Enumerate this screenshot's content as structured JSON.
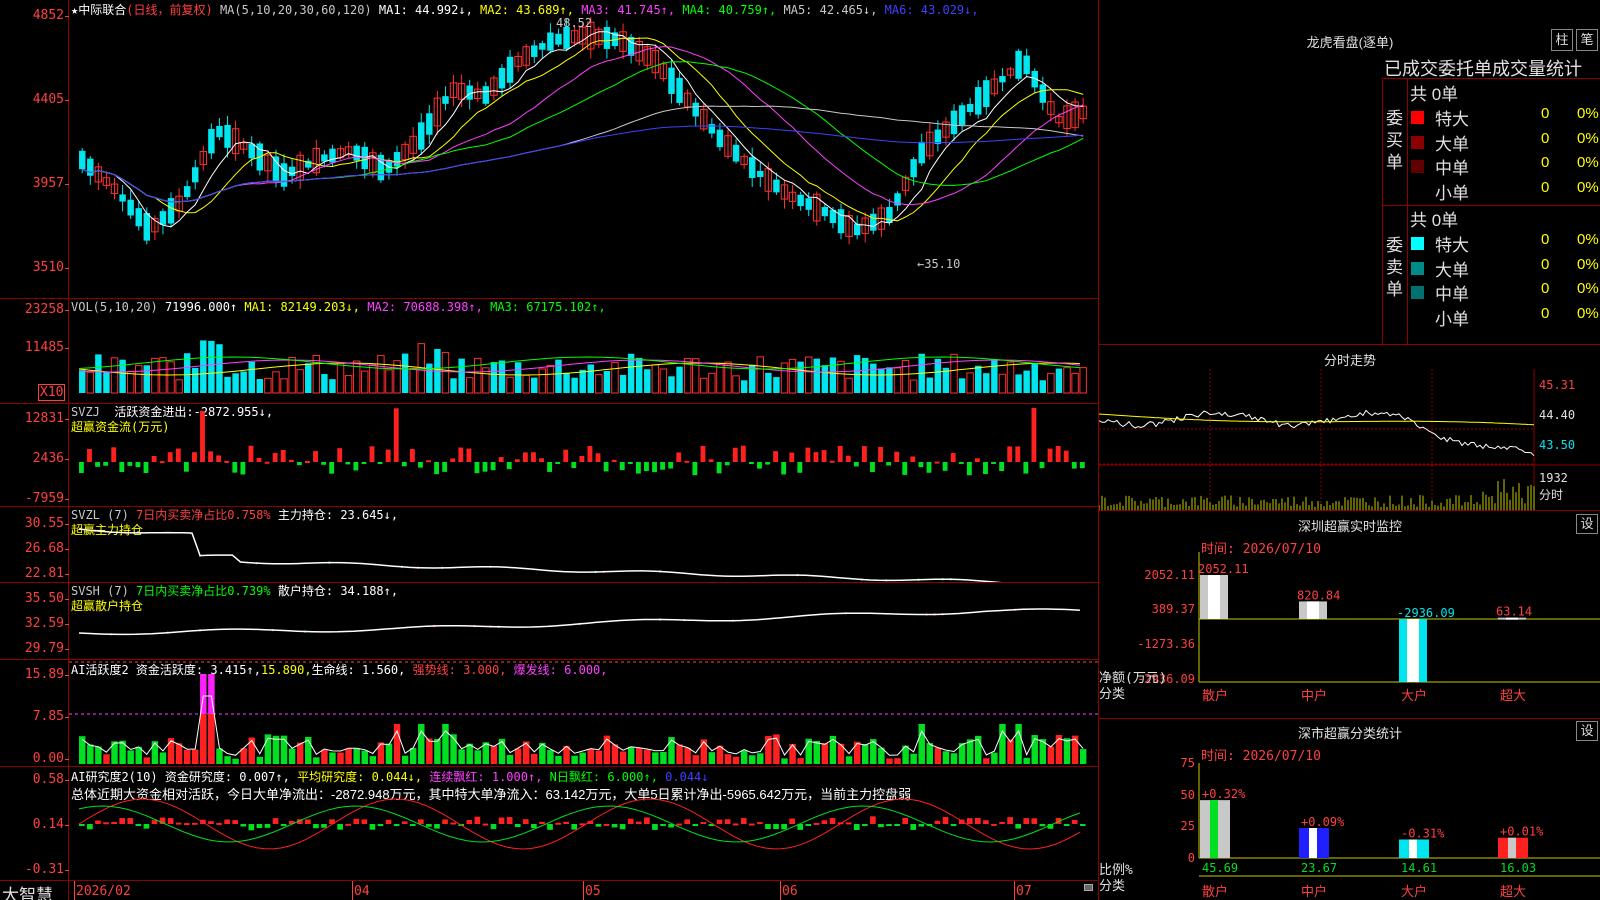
{
  "stock": {
    "name": "中际联合",
    "mode": "(日线，前复权)"
  },
  "main": {
    "ma_label": "MA(5,10,20,30,60,120)",
    "ma": [
      {
        "k": "MA1:",
        "v": "44.992↓",
        "c": "#ffffff"
      },
      {
        "k": "MA2:",
        "v": "43.689↑",
        "c": "#ffff00"
      },
      {
        "k": "MA3:",
        "v": "41.745↑",
        "c": "#ff40ff"
      },
      {
        "k": "MA4:",
        "v": "40.759↑",
        "c": "#00ff00"
      },
      {
        "k": "MA5:",
        "v": "42.465↓",
        "c": "#c8c8c8"
      },
      {
        "k": "MA6:",
        "v": "43.029↓",
        "c": "#4040ff"
      }
    ],
    "y_ticks": [
      "4852",
      "4405",
      "3957",
      "3510"
    ],
    "hi_label": "48.52",
    "lo_label": "←35.10"
  },
  "vol": {
    "label": "VOL(5,10,20)",
    "value": "71996.000↑",
    "ma": [
      {
        "k": "MA1:",
        "v": "82149.203↓",
        "c": "#ffff00"
      },
      {
        "k": "MA2:",
        "v": "70688.398↑",
        "c": "#ff40ff"
      },
      {
        "k": "MA3:",
        "v": "67175.102↑",
        "c": "#00ff00"
      }
    ],
    "y_ticks": [
      "23258",
      "11485"
    ],
    "unit": "X10"
  },
  "svzj": {
    "label": "SVZJ",
    "title": "活跃资金进出:",
    "value": "-2872.955↓,",
    "sub": "超赢资金流(万元)",
    "y_ticks": [
      "12831",
      "2436",
      "-7959"
    ]
  },
  "svzl": {
    "label": "SVZL (7)",
    "t1": "7日内买卖净占比0.758%",
    "t2": "主力持仓:",
    "v2": "23.645↓,",
    "sub": "超赢主力持仓",
    "y_ticks": [
      "30.55",
      "26.68",
      "22.81"
    ]
  },
  "svsh": {
    "label": "SVSH (7)",
    "t1": "7日内买卖净占比0.739%",
    "t2": "散户持仓:",
    "v2": "34.188↑,",
    "sub": "超赢散户持仓",
    "y_ticks": [
      "35.50",
      "32.59",
      "29.79"
    ]
  },
  "ai1": {
    "label": "AI活跃度2",
    "t1": "资金活跃度:",
    "v1": "3.415↑,",
    "v2": "15.890,",
    "t3": "生命线:",
    "v3": "1.560,",
    "t4": "强势线:",
    "v4": "3.000,",
    "t5": "爆发线:",
    "v5": "6.000,",
    "y_ticks": [
      "15.89",
      "7.85",
      "0.00"
    ]
  },
  "ai2": {
    "label": "AI研究度2(10)",
    "t1": "资金研究度:",
    "v1": "0.007↑,",
    "t2": "平均研究度:",
    "v2": "0.044↓,",
    "t3": "连续飘红:",
    "v3": "1.000↑,",
    "t4": "N日飘红:",
    "v4": "6.000↑,",
    "v5": "0.044↓",
    "summary": "总体近期大资金相对活跃，今日大单净流出：-2872.948万元，其中特大单净流入：63.142万元，大单5日累计净出-5965.642万元，当前主力控盘弱",
    "y_ticks": [
      "0.58",
      "0.14",
      "-0.31"
    ]
  },
  "bottom": {
    "brand": "大智慧",
    "dates": [
      "2026/02",
      "04",
      "05",
      "06",
      "07"
    ]
  },
  "longhu": {
    "title": "龙虎看盘(逐单)",
    "btn1": "柱",
    "btn2": "笔",
    "subtitle": "已成交委托单成交量统计",
    "buy": {
      "side": "委买单",
      "total": "共 0单",
      "rows": [
        {
          "n": "特大",
          "v": "0",
          "p": "0%",
          "c": "#ff0000"
        },
        {
          "n": "大单",
          "v": "0",
          "p": "0%",
          "c": "#8b0000"
        },
        {
          "n": "中单",
          "v": "0",
          "p": "0%",
          "c": "#600000"
        },
        {
          "n": "小单",
          "v": "0",
          "p": "0%",
          "c": ""
        }
      ]
    },
    "sell": {
      "side": "委卖单",
      "total": "共 0单",
      "rows": [
        {
          "n": "特大",
          "v": "0",
          "p": "0%",
          "c": "#00ffff"
        },
        {
          "n": "大单",
          "v": "0",
          "p": "0%",
          "c": "#008b8b"
        },
        {
          "n": "中单",
          "v": "0",
          "p": "0%",
          "c": "#007070"
        },
        {
          "n": "小单",
          "v": "0",
          "p": "0%",
          "c": ""
        }
      ]
    }
  },
  "fenshi": {
    "title": "分时走势",
    "y_ticks": [
      "45.31",
      "44.40",
      "43.50"
    ],
    "vol": "1932",
    "foot": "分时"
  },
  "sz_monitor": {
    "title": "深圳超赢实时监控",
    "btn": "设",
    "time": "时间: 2026/07/10",
    "y_ticks": [
      "2052.11",
      "389.37",
      "-1273.36",
      "-2936.09"
    ],
    "bars": [
      {
        "cat": "散户",
        "val": "2052.11"
      },
      {
        "cat": "中户",
        "val": "820.84"
      },
      {
        "cat": "大户",
        "val": "-2936.09"
      },
      {
        "cat": "超大",
        "val": "63.14"
      }
    ],
    "unit": "净额(万元)",
    "unit2": "分类"
  },
  "sz_class": {
    "title": "深市超赢分类统计",
    "btn": "设",
    "time": "时间: 2026/07/10",
    "y_ticks": [
      "75",
      "50",
      "25",
      "0"
    ],
    "bars": [
      {
        "cat": "散户",
        "val": "45.69",
        "chg": "+0.32%"
      },
      {
        "cat": "中户",
        "val": "23.67",
        "chg": "+0.09%"
      },
      {
        "cat": "大户",
        "val": "14.61",
        "chg": "-0.31%"
      },
      {
        "cat": "超大",
        "val": "16.03",
        "chg": "+0.01%"
      }
    ],
    "unit": "比例%",
    "unit2": "分类"
  }
}
